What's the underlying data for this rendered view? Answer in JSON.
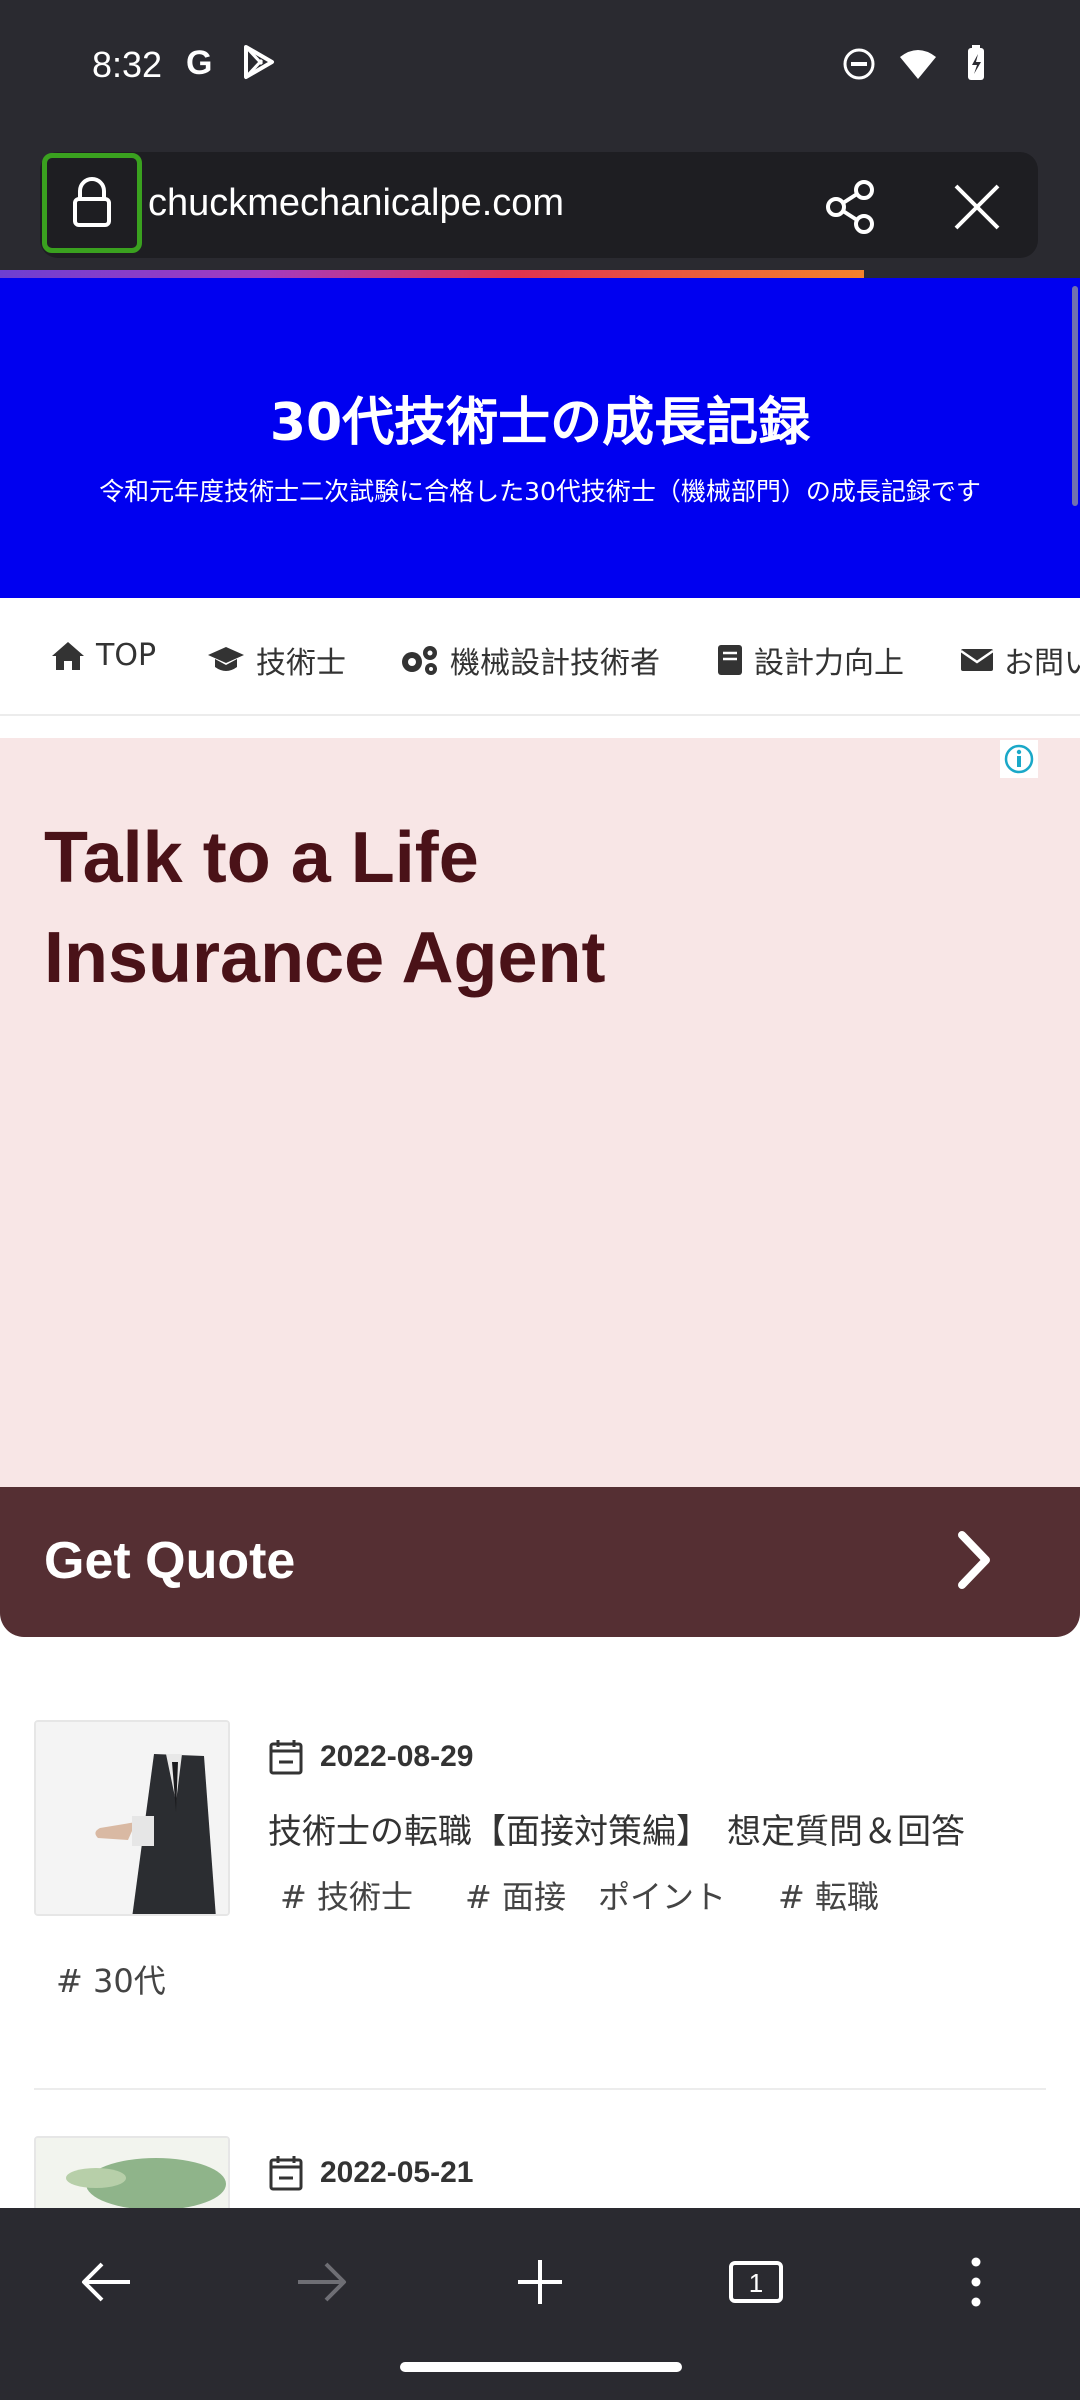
{
  "status_bar": {
    "time": "8:32",
    "left_icons": [
      "google-icon",
      "play-store-icon"
    ],
    "right_icons": [
      "do-not-disturb-icon",
      "wifi-icon",
      "battery-charging-icon"
    ]
  },
  "browser": {
    "url": "chuckmechanicalpe.com",
    "icons": [
      "lock-icon",
      "share-icon",
      "close-icon"
    ]
  },
  "hero": {
    "title": "30代技術士の成長記録",
    "subtitle": "令和元年度技術士二次試験に合格した30代技術士（機械部門）の成長記録です",
    "background": "#0000f0"
  },
  "nav": {
    "items": [
      {
        "label": "TOP",
        "icon": "home-icon"
      },
      {
        "label": "技術士",
        "icon": "graduation-cap-icon"
      },
      {
        "label": "機械設計技術者",
        "icon": "gears-icon"
      },
      {
        "label": "設計力向上",
        "icon": "book-icon"
      },
      {
        "label": "お問い",
        "icon": "envelope-icon"
      }
    ]
  },
  "ad": {
    "headline_line1": "Talk to a Life",
    "headline_line2": "Insurance Agent",
    "cta": "Get Quote",
    "background": "#f8e6e6",
    "cta_color": "#552f33",
    "headline_color": "#4a1218"
  },
  "posts": [
    {
      "date": "2022-08-29",
      "title": "技術士の転職【面接対策編】　想定質問＆回答",
      "tags": [
        "# 技術士",
        "# 面接　ポイント",
        "# 転職"
      ],
      "tags_overflow": "# 30代"
    },
    {
      "date": "2022-05-21"
    }
  ],
  "bottom_bar": {
    "icons": [
      "back-arrow-icon",
      "forward-arrow-icon",
      "new-tab-icon",
      "tab-count-icon",
      "more-menu-icon"
    ],
    "tab_count": "1"
  }
}
